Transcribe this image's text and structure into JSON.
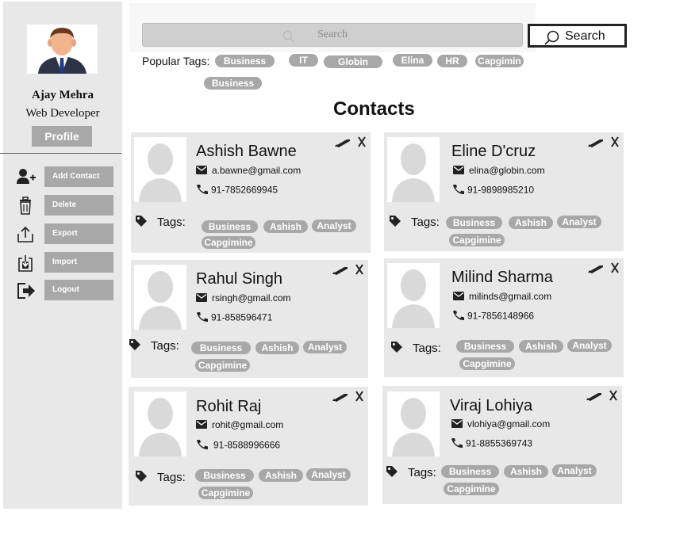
{
  "sidebar": {
    "user_name": "Ajay Mehra",
    "user_role": "Web Developer",
    "profile_label": "Profile",
    "menu": [
      {
        "label": "Add Contact",
        "icon": "add-user-icon"
      },
      {
        "label": "Delete",
        "icon": "trash-icon"
      },
      {
        "label": "Export",
        "icon": "export-icon"
      },
      {
        "label": "Import",
        "icon": "import-icon"
      },
      {
        "label": "Logout",
        "icon": "logout-icon"
      }
    ]
  },
  "search": {
    "placeholder": "Search",
    "button_label": "Search"
  },
  "popular_tags": {
    "label": "Popular Tags:",
    "tags": [
      "Business",
      "IT",
      "Globin",
      "Elina",
      "HR",
      "Capgimin",
      "Business"
    ]
  },
  "contacts_title": "Contacts",
  "tags_label": "Tags:",
  "contacts": [
    {
      "name": "Ashish Bawne",
      "email": "a.bawne@gmail.com",
      "phone": "91-7852669945",
      "tags": [
        "Business",
        "Ashish",
        "Analyst",
        "Capgimine"
      ]
    },
    {
      "name": "Eline D'cruz",
      "email": "elina@globin.com",
      "phone": "91-9898985210",
      "tags": [
        "Business",
        "Ashish",
        "Analyst",
        "Capgimine"
      ]
    },
    {
      "name": "Rahul Singh",
      "email": "rsingh@gmail.com",
      "phone": "91-858596471",
      "tags": [
        "Business",
        "Ashish",
        "Analyst",
        "Capgimine"
      ]
    },
    {
      "name": "Milind Sharma",
      "email": "milinds@gmail.com",
      "phone": "91-7856148966",
      "tags": [
        "Business",
        "Ashish",
        "Analyst",
        "Capgimine"
      ]
    },
    {
      "name": "Rohit Raj",
      "email": "rohit@gmail.com",
      "phone": "91-8588996666",
      "tags": [
        "Business",
        "Ashish",
        "Analyst",
        "Capgimine"
      ]
    },
    {
      "name": "Viraj Lohiya",
      "email": "vlohiya@gmail.com",
      "phone": "91-8855369743",
      "tags": [
        "Business",
        "Ashish",
        "Analyst",
        "Capgimine"
      ]
    }
  ],
  "colors": {
    "sidebar_bg": "#e8e8e8",
    "button_gray": "#a8a8a8",
    "card_bg": "#e8e8e8"
  }
}
